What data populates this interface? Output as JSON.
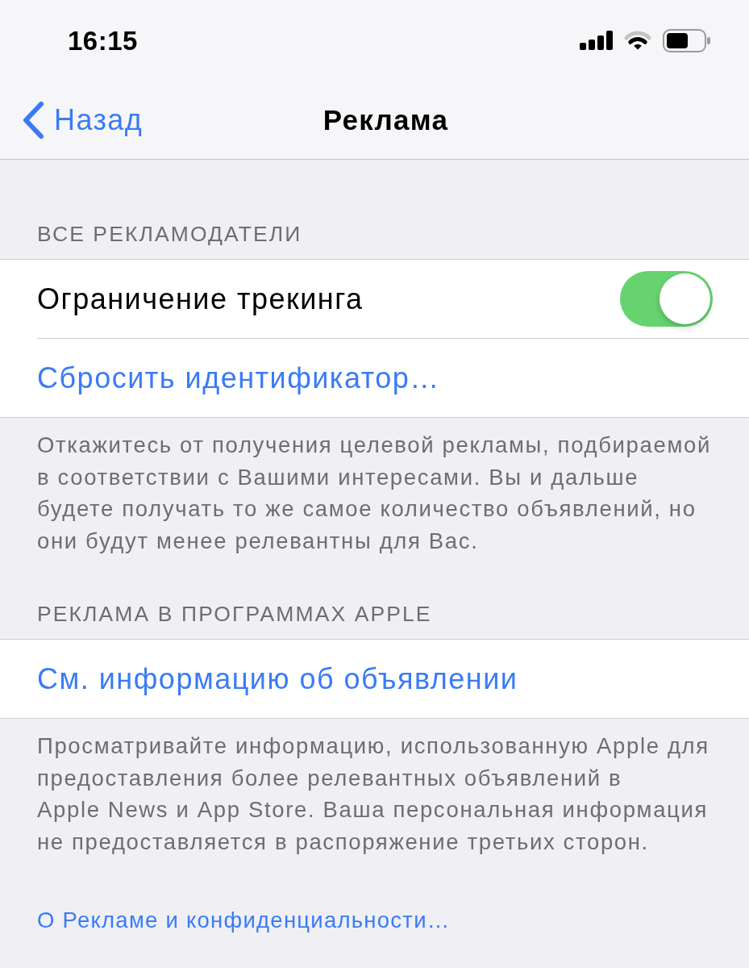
{
  "status_bar": {
    "time": "16:15"
  },
  "nav_bar": {
    "back": "Назад",
    "title": "Реклама"
  },
  "sections": [
    {
      "header": "ВСЕ РЕКЛАМОДАТЕЛИ",
      "rows": [
        {
          "kind": "toggle",
          "label": "Ограничение трекинга",
          "on": true
        },
        {
          "kind": "link",
          "label": "Сбросить идентификатор…"
        }
      ],
      "footer": "Откажитесь от получения целевой рекламы, подбираемой в соответствии с Вашими интересами. Вы и дальше будете получать то же самое количество объявлений, но они будут менее релевантны для Вас."
    },
    {
      "header": "РЕКЛАМА В ПРОГРАММАХ APPLE",
      "rows": [
        {
          "kind": "link",
          "label": "См. информацию об объявлении"
        }
      ],
      "footer": "Просматривайте информацию, использованную Apple для предоставления более релевантных объявлений в Apple News и App Store. Ваша персональная информация не предоставляется в распоряжение третьих сторон."
    }
  ],
  "bottom_link": "О Рекламе и конфиденциальности…"
}
